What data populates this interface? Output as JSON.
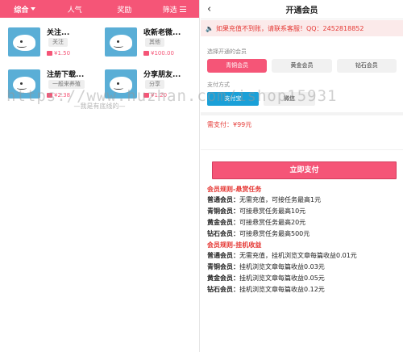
{
  "left": {
    "tabs": [
      {
        "label": "综合",
        "has_caret": true
      },
      {
        "label": "人气"
      },
      {
        "label": "奖励"
      },
      {
        "label": "筛选",
        "has_filter_icon": true
      }
    ],
    "cards": [
      {
        "title": "关注...",
        "tag": "关注",
        "price": "1.50"
      },
      {
        "title": "收新老微...",
        "tag": "其他",
        "price": "100.00"
      },
      {
        "title": "注册下载...",
        "tag": "一般来养殖",
        "price": "2.38"
      },
      {
        "title": "分享朋友...",
        "tag": "分享",
        "price": "1.20"
      }
    ],
    "end_text": "—我是有底线的—"
  },
  "right": {
    "header_title": "开通会员",
    "back_glyph": "‹",
    "notice": "如果充值不到账，请联系客服！QQ：2452818852",
    "tier_label": "选择开通的会员",
    "tiers": [
      "青铜会员",
      "黄金会员",
      "钻石会员"
    ],
    "selected_tier": "青铜会员",
    "pay_label": "支付方式",
    "pay_methods": [
      "支付宝",
      "微信"
    ],
    "selected_pay": "支付宝",
    "payable": "需支付：¥99元",
    "pay_button": "立即支付",
    "rules": [
      {
        "heading": "会员规则-悬赏任务",
        "items": [
          {
            "name": "普通会员：",
            "desc": "无需充值，可接任务最高1元"
          },
          {
            "name": "青铜会员：",
            "desc": "可接悬赏任务最高10元"
          },
          {
            "name": "黄金会员：",
            "desc": "可接悬赏任务最高20元"
          },
          {
            "name": "钻石会员：",
            "desc": "可接悬赏任务最高500元"
          }
        ]
      },
      {
        "heading": "会员规则-挂机收益",
        "items": [
          {
            "name": "普通会员：",
            "desc": "无需充值，挂机浏览文章每篇收益0.01元"
          },
          {
            "name": "青铜会员：",
            "desc": "挂机浏览文章每篇收益0.03元"
          },
          {
            "name": "黄金会员：",
            "desc": "挂机浏览文章每篇收益0.05元"
          },
          {
            "name": "钻石会员：",
            "desc": "挂机浏览文章每篇收益0.12元"
          }
        ]
      }
    ]
  },
  "watermark": "https://www.huzhan.com/ishop15931",
  "colors": {
    "accent": "#f55577",
    "pay_selected": "#1aa0d8",
    "notice_text": "#e53935"
  }
}
